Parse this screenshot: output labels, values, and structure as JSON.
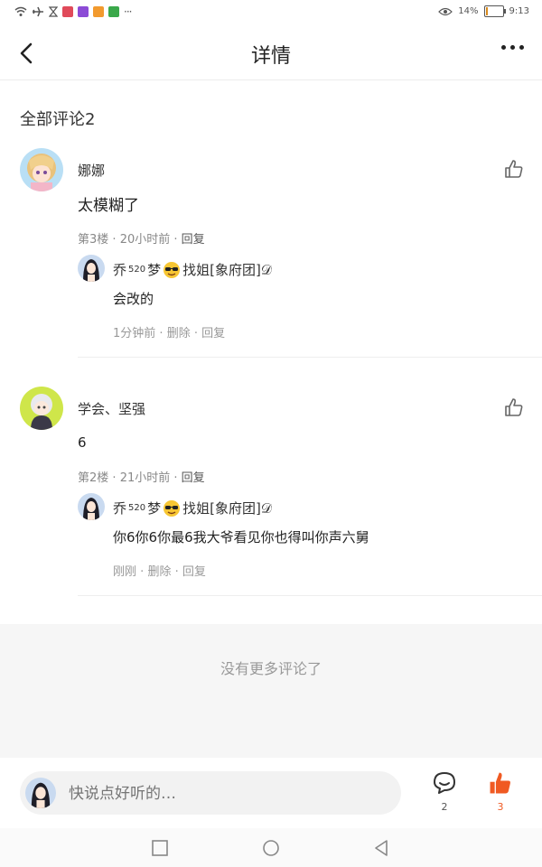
{
  "status_bar": {
    "battery_percent": "14%",
    "time": "9:13",
    "more": "···",
    "icons": [
      "wifi-icon",
      "airplane-icon",
      "hourglass-icon",
      "app-icon-red",
      "app-icon-purple",
      "app-icon-orange",
      "app-icon-green",
      "eye-icon",
      "battery-icon"
    ],
    "battery_level": 0.14
  },
  "nav": {
    "title": "详情",
    "back_icon": "back-arrow-icon",
    "more_icon": "more-dots-icon"
  },
  "comments_header": "全部评论2",
  "comments": [
    {
      "name": "娜娜",
      "body": "太模糊了",
      "floor": "第3楼",
      "time": "20小时前",
      "reply_label": "回复",
      "reply": {
        "name_prefix": "乔",
        "name_sup": "520",
        "name_mid": "梦",
        "name_suffix": "找姐[象府团]𝒟",
        "body": "会改的",
        "time": "1分钟前",
        "delete_label": "删除",
        "reply_label": "回复"
      }
    },
    {
      "name": "学会、坚强",
      "body": "6",
      "floor": "第2楼",
      "time": "21小时前",
      "reply_label": "回复",
      "reply": {
        "name_prefix": "乔",
        "name_sup": "520",
        "name_mid": "梦",
        "name_suffix": "找姐[象府团]𝒟",
        "body": "你6你6你最6我大爷看见你也得叫你声六舅",
        "time": "刚刚",
        "delete_label": "删除",
        "reply_label": "回复"
      }
    }
  ],
  "meta_separator": "·",
  "no_more": "没有更多评论了",
  "input": {
    "placeholder": "快说点好听的…"
  },
  "actions": {
    "comment_count": "2",
    "like_count": "3"
  },
  "colors": {
    "accent": "#f05a22",
    "no_more_bg": "#f6f6f6"
  }
}
